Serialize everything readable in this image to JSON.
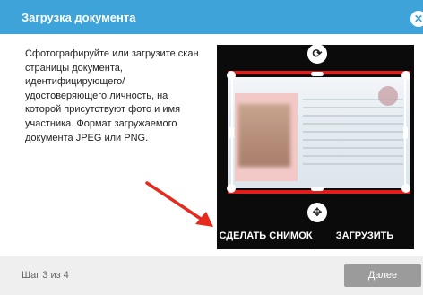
{
  "dialog": {
    "title": "Загрузка документа",
    "close_icon": "close-icon",
    "instructions": "Сфотографируйте или загрузите скан страницы документа, идентифицирующего/ удостоверяющего личность, на которой присутствуют фото и имя участника. Формат загружаемого документа JPEG или PNG."
  },
  "camera": {
    "rotate_icon": "rotate-icon",
    "move_icon": "move-icon",
    "snapshot_label": "СДЕЛАТЬ СНИМОК",
    "upload_label": "ЗАГРУЗИТЬ"
  },
  "footer": {
    "step_text": "Шаг 3 из 4",
    "next_label": "Далее"
  },
  "colors": {
    "header": "#3da3d8",
    "frame_red": "#e11d1d",
    "arrow_red": "#e52b1e",
    "camera_bg": "#0b0b0b",
    "next_button": "#9b9b9b"
  }
}
